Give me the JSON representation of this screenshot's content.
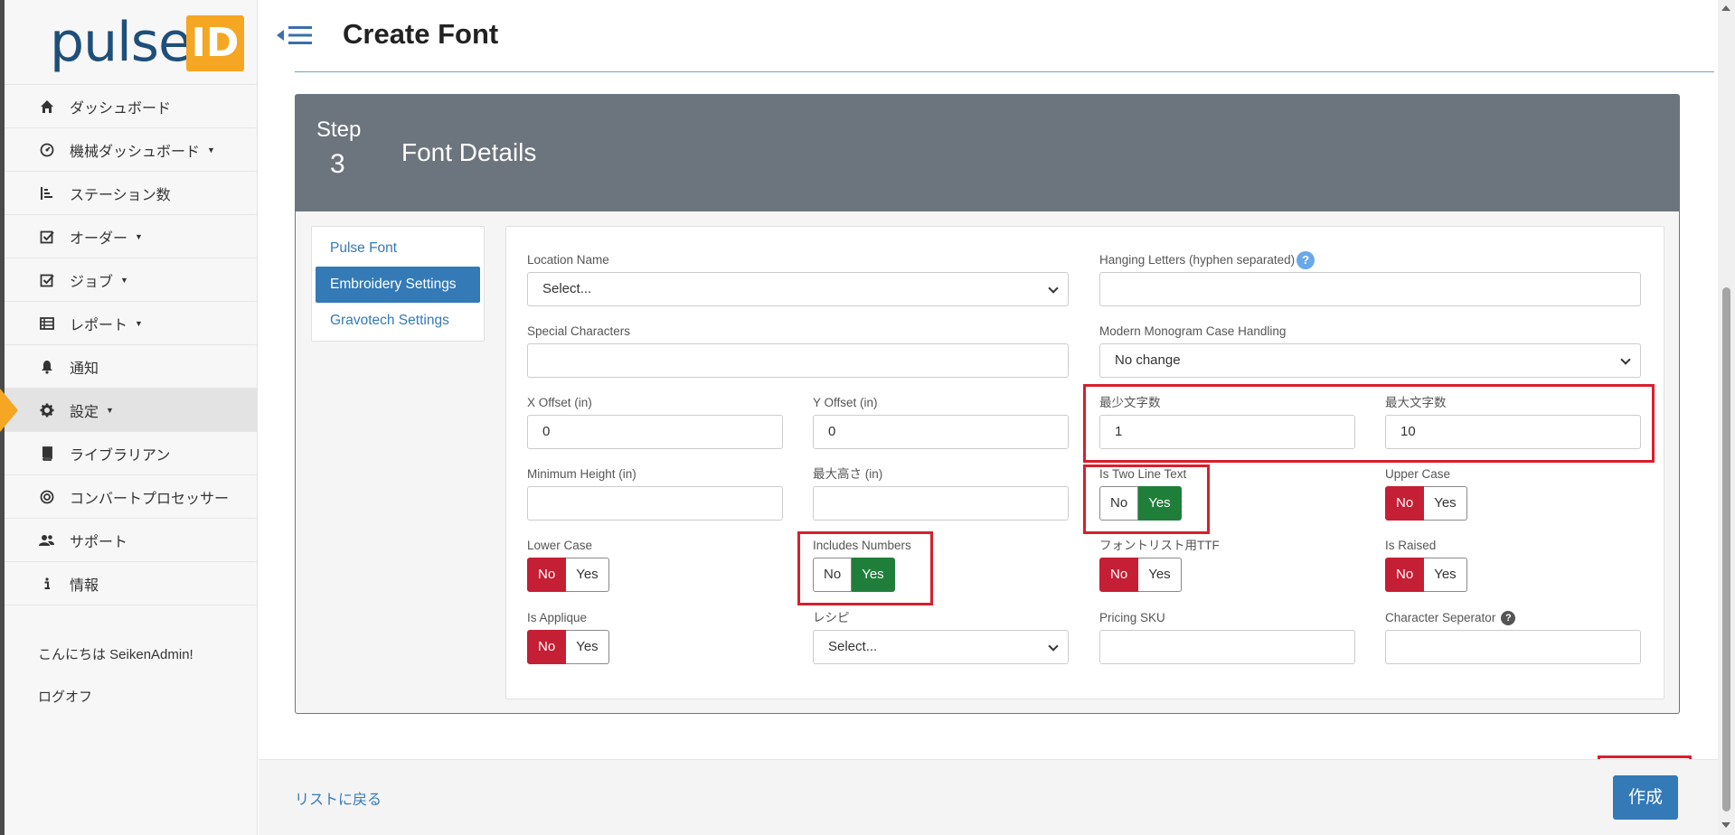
{
  "logo": {
    "text": "pulse",
    "badge": "ID"
  },
  "sidebar": {
    "items": [
      {
        "label": "ダッシュボード",
        "icon": "home-icon",
        "caret": false
      },
      {
        "label": "機械ダッシュボード",
        "icon": "gauge-icon",
        "caret": true
      },
      {
        "label": "ステーション数",
        "icon": "stations-icon",
        "caret": false
      },
      {
        "label": "オーダー",
        "icon": "checkbox-icon",
        "caret": true
      },
      {
        "label": "ジョブ",
        "icon": "checkbox-icon",
        "caret": true
      },
      {
        "label": "レポート",
        "icon": "table-icon",
        "caret": true
      },
      {
        "label": "通知",
        "icon": "bell-icon",
        "caret": false
      },
      {
        "label": "設定",
        "icon": "gear-icon",
        "caret": true,
        "active": true
      },
      {
        "label": "ライブラリアン",
        "icon": "book-icon",
        "caret": false
      },
      {
        "label": "コンバートプロセッサー",
        "icon": "target-icon",
        "caret": false
      },
      {
        "label": "サポート",
        "icon": "people-icon",
        "caret": false
      },
      {
        "label": "情報",
        "icon": "info-icon",
        "caret": false
      }
    ],
    "greeting": "こんにちは SeikenAdmin!",
    "logout": "ログオフ"
  },
  "header": {
    "title": "Create Font"
  },
  "step": {
    "label": "Step",
    "number": "3",
    "title": "Font Details"
  },
  "tabs": [
    {
      "label": "Pulse Font",
      "active": false
    },
    {
      "label": "Embroidery Settings",
      "active": true
    },
    {
      "label": "Gravotech Settings",
      "active": false
    }
  ],
  "form": {
    "location_name": {
      "label": "Location Name",
      "value": "Select..."
    },
    "hanging_letters": {
      "label": "Hanging Letters (hyphen separated)",
      "value": ""
    },
    "special_characters": {
      "label": "Special Characters",
      "value": ""
    },
    "monogram_case": {
      "label": "Modern Monogram Case Handling",
      "value": "No change"
    },
    "x_offset": {
      "label": "X Offset (in)",
      "value": "0"
    },
    "y_offset": {
      "label": "Y Offset (in)",
      "value": "0"
    },
    "min_chars": {
      "label": "最少文字数",
      "value": "1"
    },
    "max_chars": {
      "label": "最大文字数",
      "value": "10"
    },
    "min_height": {
      "label": "Minimum Height (in)",
      "value": ""
    },
    "max_height": {
      "label": "最大高さ (in)",
      "value": ""
    },
    "two_line": {
      "label": "Is Two Line Text",
      "selected": "Yes"
    },
    "upper_case": {
      "label": "Upper Case",
      "selected": "No"
    },
    "lower_case": {
      "label": "Lower Case",
      "selected": "No"
    },
    "includes_numbers": {
      "label": "Includes Numbers",
      "selected": "Yes"
    },
    "font_list_ttf": {
      "label": "フォントリスト用TTF",
      "selected": "No"
    },
    "is_raised": {
      "label": "Is Raised",
      "selected": "No"
    },
    "is_applique": {
      "label": "Is Applique",
      "selected": "No"
    },
    "recipe": {
      "label": "レシピ",
      "value": "Select..."
    },
    "pricing_sku": {
      "label": "Pricing SKU",
      "value": ""
    },
    "char_separator": {
      "label": "Character Seperator",
      "value": ""
    }
  },
  "toggle": {
    "no": "No",
    "yes": "Yes"
  },
  "help_icon": "?",
  "footer": {
    "back": "リストに戻る",
    "create": "作成"
  },
  "colors": {
    "primary": "#337ab7",
    "danger": "#c41f35",
    "success": "#1f7f3a",
    "highlight": "#d81f2c",
    "brand_orange": "#f5a623"
  }
}
